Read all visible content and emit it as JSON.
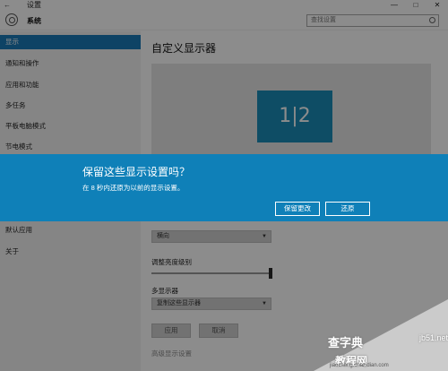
{
  "window": {
    "back_glyph": "←",
    "title": "设置",
    "minimize": "—",
    "maximize": "□",
    "close": "✕"
  },
  "header": {
    "app_title": "系统",
    "search_placeholder": "查找设置"
  },
  "sidebar": {
    "items": [
      {
        "label": "显示",
        "active": true
      },
      {
        "label": "通知和操作"
      },
      {
        "label": "应用和功能"
      },
      {
        "label": "多任务"
      },
      {
        "label": "平板电脑模式"
      },
      {
        "label": "节电模式"
      },
      {
        "label": "默认应用"
      },
      {
        "label": "关于"
      }
    ]
  },
  "content": {
    "title": "自定义显示器",
    "monitor_label": "1|2",
    "orientation_value": "横向",
    "brightness_label": "调整亮度级别",
    "brightness_level": 1.0,
    "multi_display_label": "多显示器",
    "multi_display_value": "复制这些显示器",
    "apply_button": "应用",
    "cancel_button": "取消",
    "advanced_link": "高级显示设置"
  },
  "dialog": {
    "title": "保留这些显示设置吗？",
    "message": "在  8 秒内还原为以前的显示设置。",
    "keep_button": "保留更改",
    "revert_button": "还原"
  },
  "watermark": {
    "site_cn": "查字典",
    "site_en": "jb51.net",
    "tutorial": "教程网",
    "url": "jiaocheng.chazidian.com"
  },
  "colors": {
    "accent": "#1a7ab8",
    "dialog_bg": "#0f80b8",
    "monitor_tile": "#1a8cb8"
  }
}
